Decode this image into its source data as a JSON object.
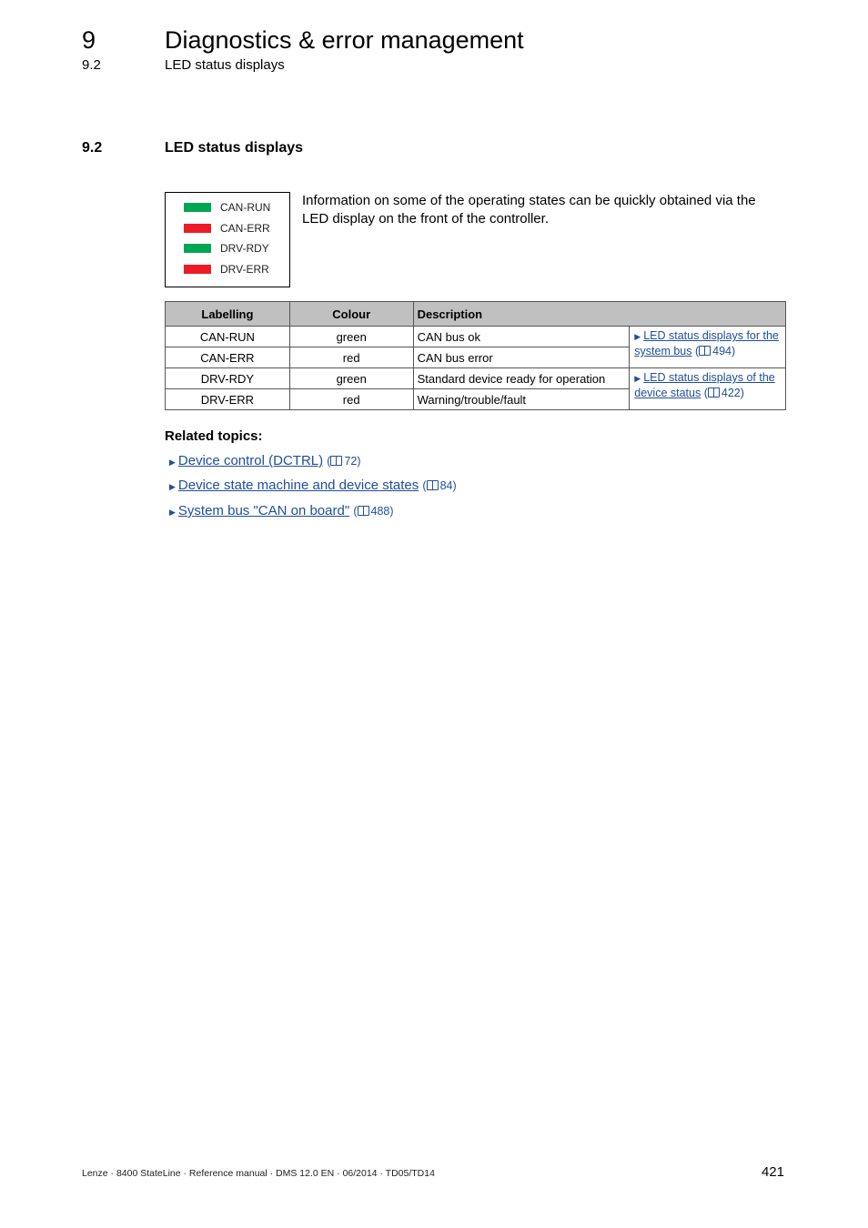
{
  "header": {
    "chapter_number": "9",
    "chapter_title": "Diagnostics & error management",
    "section_number": "9.2",
    "section_title": "LED status displays",
    "separator": "_ _ _ _ _ _ _ _ _ _ _ _ _ _ _ _ _ _ _ _ _ _ _ _ _ _ _ _ _ _ _ _ _ _ _ _ _ _ _ _ _ _ _ _ _ _ _ _ _ _ _ _ _ _ _ _ _ _ _ _ _ _ _ _ _ _"
  },
  "section": {
    "number": "9.2",
    "title": "LED status displays",
    "intro": "Information on some of the operating states can be quickly obtained via the LED display on the front of the controller."
  },
  "led_panel": {
    "leds": [
      {
        "label": "CAN-RUN",
        "color": "#00a651"
      },
      {
        "label": "CAN-ERR",
        "color": "#ed1c24"
      },
      {
        "label": "DRV-RDY",
        "color": "#00a651"
      },
      {
        "label": "DRV-ERR",
        "color": "#ed1c24"
      }
    ]
  },
  "table": {
    "headers": [
      "Labelling",
      "Colour",
      "Description"
    ],
    "rows": [
      {
        "label": "CAN-RUN",
        "colour": "green",
        "description": "CAN bus ok"
      },
      {
        "label": "CAN-ERR",
        "colour": "red",
        "description": "CAN bus error"
      },
      {
        "label": "DRV-RDY",
        "colour": "green",
        "description": "Standard device ready for operation"
      },
      {
        "label": "DRV-ERR",
        "colour": "red",
        "description": "Warning/trouble/fault"
      }
    ],
    "links": [
      {
        "text": "LED status displays for the system bus",
        "page": "494"
      },
      {
        "text": "LED status displays of the device status",
        "page": "422"
      }
    ]
  },
  "related": {
    "heading": "Related topics:",
    "items": [
      {
        "text": "Device control (DCTRL)",
        "page": "72"
      },
      {
        "text": "Device state machine and device states",
        "page": "84"
      },
      {
        "text": "System bus \"CAN on board\"",
        "page": "488"
      }
    ]
  },
  "footer": {
    "text": "Lenze · 8400 StateLine · Reference manual · DMS 12.0 EN · 06/2014 · TD05/TD14",
    "page_number": "421"
  },
  "colors": {
    "link": "#1f4e9c",
    "table_header_bg": "#c0c0c0",
    "led_green": "#00a651",
    "led_red": "#ed1c24"
  }
}
